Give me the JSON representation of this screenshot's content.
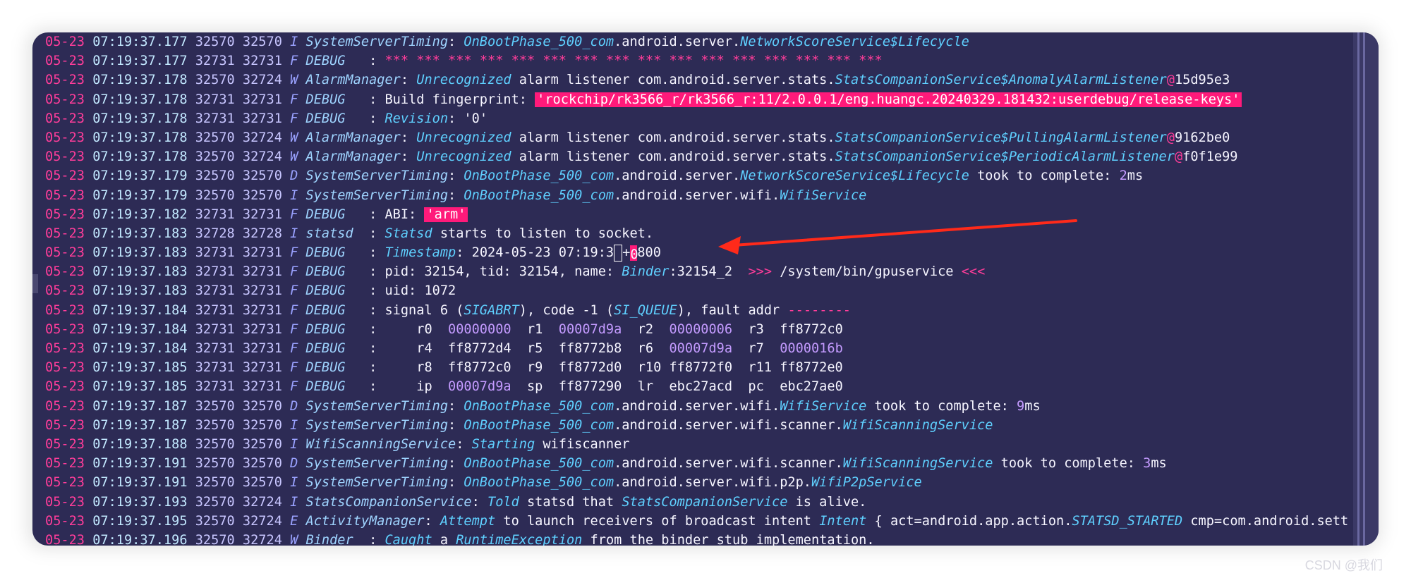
{
  "colors": {
    "background": "#2d2b55",
    "date": "#ff3d9a",
    "time": "#c2e8ff",
    "highlight": "#ff1a7a",
    "tag": "#9fd4ff",
    "class": "#5fd0ff",
    "number": "#c49bff",
    "arrow": "#ff2a1a"
  },
  "log_lines": [
    "05-23 07:19:37.177 32570 32570 I SystemServerTiming: OnBootPhase_500_com.android.server.NetworkScoreService$Lifecycle",
    "05-23 07:19:37.177 32731 32731 F DEBUG   : *** *** *** *** *** *** *** *** *** *** *** *** *** *** *** ***",
    "05-23 07:19:37.178 32570 32724 W AlarmManager: Unrecognized alarm listener com.android.server.stats.StatsCompanionService$AnomalyAlarmListener@15d95e3",
    "05-23 07:19:37.178 32731 32731 F DEBUG   : Build fingerprint: 'rockchip/rk3566_r/rk3566_r:11/2.0.0.1/eng.huangc.20240329.181432:userdebug/release-keys'",
    "05-23 07:19:37.178 32731 32731 F DEBUG   : Revision: '0'",
    "05-23 07:19:37.178 32570 32724 W AlarmManager: Unrecognized alarm listener com.android.server.stats.StatsCompanionService$PullingAlarmListener@9162be0",
    "05-23 07:19:37.178 32570 32724 W AlarmManager: Unrecognized alarm listener com.android.server.stats.StatsCompanionService$PeriodicAlarmListener@f0f1e99",
    "05-23 07:19:37.179 32570 32570 D SystemServerTiming: OnBootPhase_500_com.android.server.NetworkScoreService$Lifecycle took to complete: 2ms",
    "05-23 07:19:37.179 32570 32570 I SystemServerTiming: OnBootPhase_500_com.android.server.wifi.WifiService",
    "05-23 07:19:37.182 32731 32731 F DEBUG   : ABI: 'arm'",
    "05-23 07:19:37.183 32728 32728 I statsd  : Statsd starts to listen to socket.",
    "05-23 07:19:37.183 32731 32731 F DEBUG   : Timestamp: 2024-05-23 07:19:37+0800",
    "05-23 07:19:37.183 32731 32731 F DEBUG   : pid: 32154, tid: 32154, name: Binder:32154_2  >>> /system/bin/gpuservice <<<",
    "05-23 07:19:37.183 32731 32731 F DEBUG   : uid: 1072",
    "05-23 07:19:37.184 32731 32731 F DEBUG   : signal 6 (SIGABRT), code -1 (SI_QUEUE), fault addr --------",
    "05-23 07:19:37.184 32731 32731 F DEBUG   :     r0  00000000  r1  00007d9a  r2  00000006  r3  ff8772c0",
    "05-23 07:19:37.184 32731 32731 F DEBUG   :     r4  ff8772d4  r5  ff8772b8  r6  00007d9a  r7  0000016b",
    "05-23 07:19:37.185 32731 32731 F DEBUG   :     r8  ff8772c0  r9  ff8772d0  r10 ff8772f0  r11 ff8772e0",
    "05-23 07:19:37.185 32731 32731 F DEBUG   :     ip  00007d9a  sp  ff877290  lr  ebc27acd  pc  ebc27ae0",
    "05-23 07:19:37.187 32570 32570 D SystemServerTiming: OnBootPhase_500_com.android.server.wifi.WifiService took to complete: 9ms",
    "05-23 07:19:37.187 32570 32570 I SystemServerTiming: OnBootPhase_500_com.android.server.wifi.scanner.WifiScanningService",
    "05-23 07:19:37.188 32570 32570 I WifiScanningService: Starting wifiscanner",
    "05-23 07:19:37.191 32570 32570 D SystemServerTiming: OnBootPhase_500_com.android.server.wifi.scanner.WifiScanningService took to complete: 3ms",
    "05-23 07:19:37.191 32570 32570 I SystemServerTiming: OnBootPhase_500_com.android.server.wifi.p2p.WifiP2pService",
    "05-23 07:19:37.193 32570 32724 I StatsCompanionService: Told statsd that StatsCompanionService is alive.",
    "05-23 07:19:37.195 32570 32724 E ActivityManager: Attempt to launch receivers of broadcast intent Intent { act=android.app.action.STATSD_STARTED cmp=com.android.sett",
    "05-23 07:19:37.196 32570 32724 W Binder  : Caught a RuntimeException from the binder stub implementation."
  ],
  "watermark": "CSDN @我们"
}
